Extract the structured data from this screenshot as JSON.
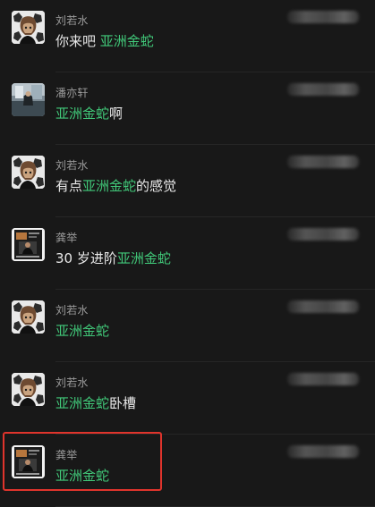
{
  "results": [
    {
      "name": "刘若水",
      "avatar": "cartoon-avatar-icon",
      "message": [
        {
          "text": "你来吧 ",
          "highlight": false
        },
        {
          "text": "亚洲金蛇",
          "highlight": true
        }
      ]
    },
    {
      "name": "潘亦轩",
      "avatar": "photo-avatar-icon",
      "message": [
        {
          "text": "亚洲金蛇",
          "highlight": true
        },
        {
          "text": "啊",
          "highlight": false
        }
      ]
    },
    {
      "name": "刘若水",
      "avatar": "cartoon-avatar-icon",
      "message": [
        {
          "text": "有点",
          "highlight": false
        },
        {
          "text": "亚洲金蛇",
          "highlight": true
        },
        {
          "text": "的感觉",
          "highlight": false
        }
      ]
    },
    {
      "name": "龚举",
      "avatar": "poster-avatar-icon",
      "message": [
        {
          "text": "30 岁进阶",
          "highlight": false
        },
        {
          "text": "亚洲金蛇",
          "highlight": true
        }
      ]
    },
    {
      "name": "刘若水",
      "avatar": "cartoon-avatar-icon",
      "message": [
        {
          "text": "亚洲金蛇",
          "highlight": true
        }
      ]
    },
    {
      "name": "刘若水",
      "avatar": "cartoon-avatar-icon",
      "message": [
        {
          "text": "亚洲金蛇",
          "highlight": true
        },
        {
          "text": "卧槽",
          "highlight": false
        }
      ]
    },
    {
      "name": "龚举",
      "avatar": "poster-avatar-icon",
      "message": [
        {
          "text": "亚洲金蛇",
          "highlight": true
        }
      ]
    }
  ],
  "colors": {
    "background": "#181818",
    "keyword_highlight": "#41c879",
    "annotation_box": "#e0342c",
    "name_text": "#9a9a9a",
    "message_text": "#e8e8e8"
  }
}
